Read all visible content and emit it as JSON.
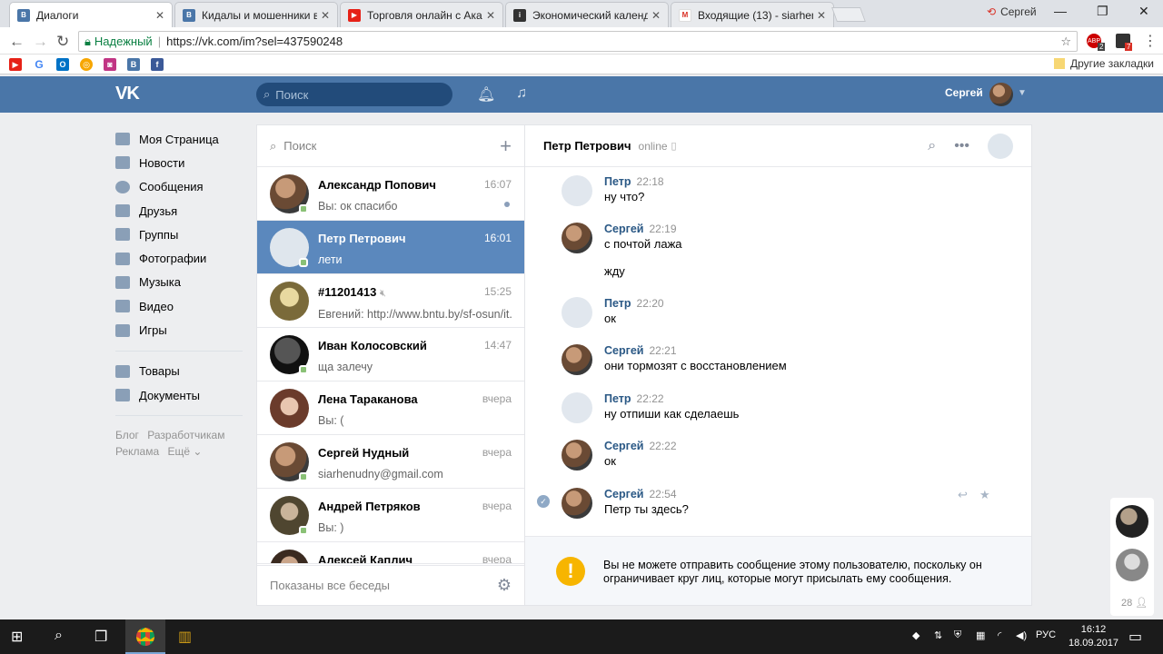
{
  "browser": {
    "tabs": [
      {
        "title": "Диалоги",
        "fav": "vk-icon",
        "color": "#4a76a8"
      },
      {
        "title": "Кидалы и мошенники в",
        "fav": "vk-icon",
        "color": "#4a76a8"
      },
      {
        "title": "Торговля онлайн с Ака",
        "fav": "youtube-icon",
        "color": "#e62117"
      },
      {
        "title": "Экономический календ",
        "fav": "investing-icon",
        "color": "#333333"
      },
      {
        "title": "Входящие (13) - siarhen",
        "fav": "gmail-icon",
        "color": "#d93025"
      }
    ],
    "profile_name": "Сергей",
    "secure_label": "Надежный",
    "url": "https://vk.com/im?sel=437590248",
    "other_bookmarks": "Другие закладки",
    "badges": {
      "abp": "2",
      "ext": "7"
    }
  },
  "vk": {
    "logo": "VK",
    "search_placeholder": "Поиск",
    "user_name": "Сергей",
    "menu": [
      "Моя Страница",
      "Новости",
      "Сообщения",
      "Друзья",
      "Группы",
      "Фотографии",
      "Музыка",
      "Видео",
      "Игры"
    ],
    "menu2": [
      "Товары",
      "Документы"
    ],
    "footer": {
      "a": "Блог",
      "b": "Разработчикам",
      "c": "Реклама",
      "d": "Ещё"
    }
  },
  "dialogs": {
    "search_placeholder": "Поиск",
    "items": [
      {
        "name": "Александр Попович",
        "time": "16:07",
        "preview": "Вы: ок спасибо",
        "online": true,
        "unread": true
      },
      {
        "name": "Петр Петрович",
        "time": "16:01",
        "preview": "лети",
        "online": true,
        "selected": true,
        "camera": true
      },
      {
        "name": "#11201413",
        "time": "15:25",
        "preview": "Евгений: http://www.bntu.by/sf-osun/it...",
        "muted": true
      },
      {
        "name": "Иван Колосовский",
        "time": "14:47",
        "preview": "ща залечу",
        "online": true
      },
      {
        "name": "Лена Тараканова",
        "time": "вчера",
        "preview": "Вы: ("
      },
      {
        "name": "Сергей Нудный",
        "time": "вчера",
        "preview": "siarhenudny@gmail.com",
        "online": true
      },
      {
        "name": "Андрей Петряков",
        "time": "вчера",
        "preview": "Вы: )",
        "online": true
      },
      {
        "name": "Алексей Каплич",
        "time": "вчера",
        "preview": ""
      }
    ],
    "footer": "Показаны все беседы"
  },
  "chat": {
    "peer_name": "Петр Петрович",
    "peer_status": "online",
    "messages": [
      {
        "author": "Петр",
        "time": "22:18",
        "text": "ну что?",
        "camera": true
      },
      {
        "author": "Сергей",
        "time": "22:19",
        "text": "с почтой лажа",
        "extra": "жду"
      },
      {
        "author": "Петр",
        "time": "22:20",
        "text": "ок",
        "camera": true
      },
      {
        "author": "Сергей",
        "time": "22:21",
        "text": "они тормозят с восстановлением"
      },
      {
        "author": "Петр",
        "time": "22:22",
        "text": "ну отпиши как сделаешь",
        "camera": true
      },
      {
        "author": "Сергей",
        "time": "22:22",
        "text": "ок"
      },
      {
        "author": "Сергей",
        "time": "22:54",
        "text": "Петр ты здесь?"
      }
    ],
    "warning": "Вы не можете отправить сообщение этому пользователю, поскольку он ограничивает круг лиц, которые могут присылать ему сообщения."
  },
  "friends_counter": "28",
  "taskbar": {
    "lang": "РУС",
    "time": "16:12",
    "date": "18.09.2017"
  }
}
